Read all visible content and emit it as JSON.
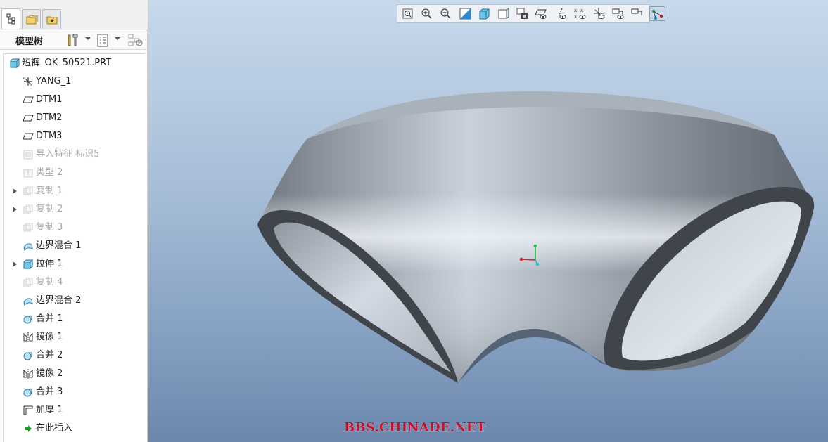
{
  "panel": {
    "tabs": [
      {
        "name": "model-tree-tab",
        "icon": "model-tree-icon"
      },
      {
        "name": "folder-browser-tab",
        "icon": "folder-browser-icon"
      },
      {
        "name": "favorites-tab",
        "icon": "favorites-icon"
      }
    ],
    "header": {
      "title": "模型树",
      "buttons": [
        "settings-icon",
        "show-tree-icon",
        "filter-icon"
      ]
    },
    "tree": [
      {
        "label": "短裤_OK_50521.PRT",
        "icon": "part-icon",
        "dim": false,
        "expandable": false,
        "level": 0
      },
      {
        "label": "YANG_1",
        "icon": "coordinate-system-icon",
        "dim": false,
        "expandable": false,
        "level": 1
      },
      {
        "label": "DTM1",
        "icon": "datum-plane-icon",
        "dim": false,
        "expandable": false,
        "level": 1
      },
      {
        "label": "DTM2",
        "icon": "datum-plane-icon",
        "dim": false,
        "expandable": false,
        "level": 1
      },
      {
        "label": "DTM3",
        "icon": "datum-plane-icon",
        "dim": false,
        "expandable": false,
        "level": 1
      },
      {
        "label": "导入特征 标识5",
        "icon": "import-feature-icon",
        "dim": true,
        "expandable": false,
        "level": 1
      },
      {
        "label": "类型 2",
        "icon": "type-feature-icon",
        "dim": true,
        "expandable": false,
        "level": 1
      },
      {
        "label": "复制 1",
        "icon": "copy-feature-icon",
        "dim": true,
        "expandable": true,
        "level": 1
      },
      {
        "label": "复制 2",
        "icon": "copy-feature-icon",
        "dim": true,
        "expandable": true,
        "level": 1
      },
      {
        "label": "复制 3",
        "icon": "copy-feature-icon",
        "dim": true,
        "expandable": false,
        "level": 1
      },
      {
        "label": "边界混合 1",
        "icon": "boundary-blend-icon",
        "dim": false,
        "expandable": false,
        "level": 1
      },
      {
        "label": "拉伸 1",
        "icon": "extrude-icon",
        "dim": false,
        "expandable": true,
        "level": 1
      },
      {
        "label": "复制 4",
        "icon": "copy-feature-icon",
        "dim": true,
        "expandable": false,
        "level": 1
      },
      {
        "label": "边界混合 2",
        "icon": "boundary-blend-icon",
        "dim": false,
        "expandable": false,
        "level": 1
      },
      {
        "label": "合并 1",
        "icon": "merge-icon",
        "dim": false,
        "expandable": false,
        "level": 1
      },
      {
        "label": "镜像 1",
        "icon": "mirror-icon",
        "dim": false,
        "expandable": false,
        "level": 1
      },
      {
        "label": "合并 2",
        "icon": "merge-icon",
        "dim": false,
        "expandable": false,
        "level": 1
      },
      {
        "label": "镜像 2",
        "icon": "mirror-icon",
        "dim": false,
        "expandable": false,
        "level": 1
      },
      {
        "label": "合并 3",
        "icon": "merge-icon",
        "dim": false,
        "expandable": false,
        "level": 1
      },
      {
        "label": "加厚 1",
        "icon": "thicken-icon",
        "dim": false,
        "expandable": false,
        "level": 1
      },
      {
        "label": "在此插入",
        "icon": "insert-here-arrow-icon",
        "dim": false,
        "expandable": false,
        "level": 1
      }
    ]
  },
  "viewport": {
    "toolbar": [
      {
        "icon": "refit-icon",
        "active": false
      },
      {
        "icon": "zoom-in-icon",
        "active": false
      },
      {
        "icon": "zoom-out-icon",
        "active": false
      },
      {
        "icon": "repaint-icon",
        "active": false
      },
      {
        "icon": "display-style-icon",
        "active": false
      },
      {
        "icon": "saved-orientations-icon",
        "active": false
      },
      {
        "icon": "view-manager-icon",
        "active": false
      },
      {
        "icon": "datum-display-filter-icon",
        "active": false
      },
      {
        "icon": "plane-display-icon",
        "active": false
      },
      {
        "icon": "axis-display-icon",
        "active": false
      },
      {
        "icon": "point-display-icon",
        "active": false
      },
      {
        "icon": "csys-display-icon",
        "active": false
      },
      {
        "icon": "annotation-display-icon",
        "active": false
      },
      {
        "icon": "spin-center-icon",
        "active": true
      }
    ],
    "watermark": "BBS.CHINADE.NET",
    "colors": {
      "background_top": "#c7d9eb",
      "background_bottom": "#6c87ad",
      "model_edge": "#3d4249",
      "axis_x": "#e02020",
      "axis_y": "#20c040",
      "axis_z": "#20c0d0"
    }
  }
}
